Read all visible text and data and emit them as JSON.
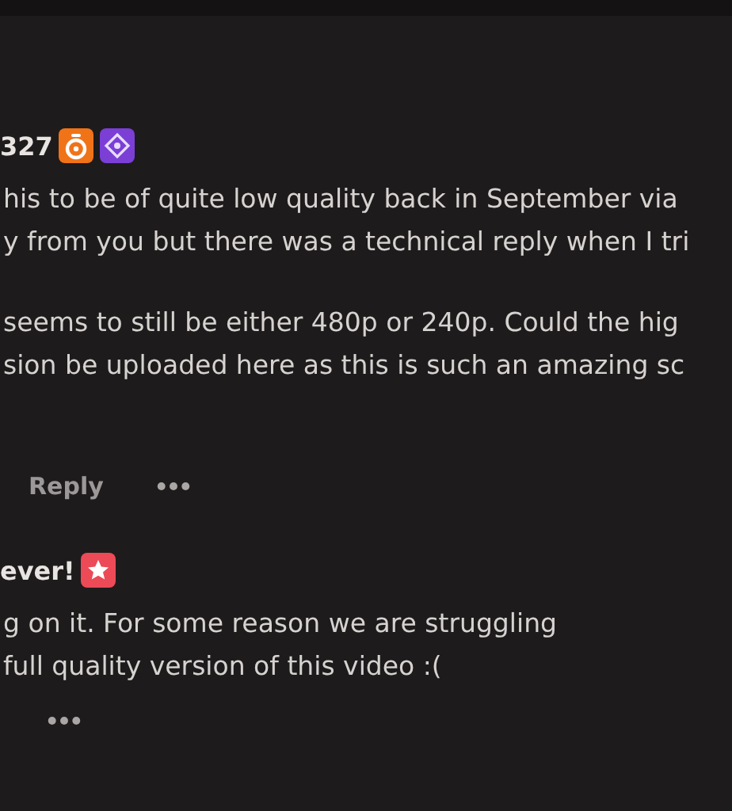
{
  "comment": {
    "author": "327",
    "badges": [
      {
        "kind": "timer"
      },
      {
        "kind": "diamond"
      }
    ],
    "paragraphs": [
      [
        "his to be of quite low quality back in September via",
        "y from you but there was a technical reply when I tri"
      ],
      [
        "seems to still be either 480p or 240p. Could the hig",
        "sion be uploaded here as this is such an amazing sc"
      ]
    ],
    "reply_label": "Reply"
  },
  "reply": {
    "author": "ever!",
    "badges": [
      {
        "kind": "star"
      }
    ],
    "paragraphs": [
      [
        "g on it. For some reason we are struggling",
        "full quality version of this video :("
      ]
    ]
  }
}
